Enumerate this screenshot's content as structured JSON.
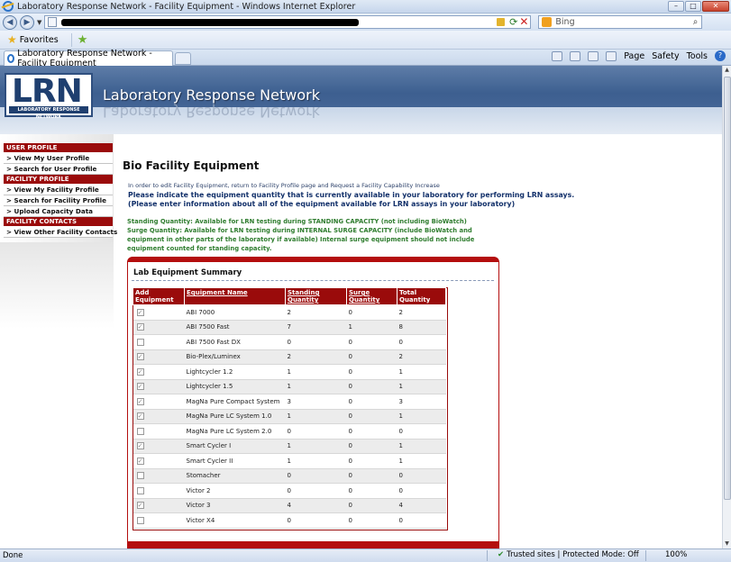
{
  "browser": {
    "window_title": "Laboratory Response Network - Facility Equipment - Windows Internet Explorer",
    "search_placeholder": "Bing",
    "favorites_label": "Favorites",
    "tab_title": "Laboratory Response Network - Facility Equipment",
    "cmd_page": "Page",
    "cmd_safety": "Safety",
    "cmd_tools": "Tools",
    "status_done": "Done",
    "status_zone": "Trusted sites | Protected Mode: Off",
    "status_zoom": "100%"
  },
  "site": {
    "logo_text": "LRN",
    "logo_subtext": "LABORATORY RESPONSE NETWORK",
    "title": "Laboratory Response Network"
  },
  "nav": {
    "user_profile_header": "USER PROFILE",
    "user_items": [
      "> View My User Profile",
      "> Search for User Profile"
    ],
    "facility_profile_header": "FACILITY PROFILE",
    "facility_items": [
      "> View My Facility Profile",
      "> Search for Facility Profile",
      "> Upload Capacity Data"
    ],
    "facility_contacts_header": "FACILITY CONTACTS",
    "contact_items": [
      "> View Other Facility Contacts"
    ]
  },
  "main": {
    "title": "Bio Facility Equipment",
    "edit_note": "In order to edit Facility Equipment, return to Facility Profile page and Request a Facility Capability Increase",
    "instruction_1": "Please indicate the equipment quantity that is currently available in your laboratory for performing LRN assays.",
    "instruction_2": "(Please enter information about all of the equipment available for LRN assays in your laboratory)",
    "standing_note": "Standing Quantity: Available for LRN testing during STANDING CAPACITY (not including BioWatch)",
    "surge_note": "Surge Quantity: Available for LRN testing during INTERNAL SURGE CAPACITY (include BioWatch and equipment in other parts of the laboratory if available) Internal surge equipment should not include equipment counted for standing capacity."
  },
  "panel": {
    "title": "Lab Equipment Summary",
    "headers": {
      "add": "Add Equipment",
      "name": "Equipment Name",
      "standing": "Standing Quantity",
      "surge": "Surge Quantity",
      "total": "Total Quantity"
    },
    "rows": [
      {
        "checked": true,
        "name": "ABI 7000",
        "standing": "2",
        "surge": "0",
        "total": "2"
      },
      {
        "checked": true,
        "name": "ABI 7500 Fast",
        "standing": "7",
        "surge": "1",
        "total": "8"
      },
      {
        "checked": false,
        "name": "ABI 7500 Fast DX",
        "standing": "0",
        "surge": "0",
        "total": "0"
      },
      {
        "checked": true,
        "name": "Bio-Plex/Luminex",
        "standing": "2",
        "surge": "0",
        "total": "2"
      },
      {
        "checked": true,
        "name": "Lightcycler 1.2",
        "standing": "1",
        "surge": "0",
        "total": "1"
      },
      {
        "checked": true,
        "name": "Lightcycler 1.5",
        "standing": "1",
        "surge": "0",
        "total": "1"
      },
      {
        "checked": true,
        "name": "MagNa Pure Compact System",
        "standing": "3",
        "surge": "0",
        "total": "3"
      },
      {
        "checked": true,
        "name": "MagNa Pure LC System 1.0",
        "standing": "1",
        "surge": "0",
        "total": "1"
      },
      {
        "checked": false,
        "name": "MagNa Pure LC System 2.0",
        "standing": "0",
        "surge": "0",
        "total": "0"
      },
      {
        "checked": true,
        "name": "Smart Cycler I",
        "standing": "1",
        "surge": "0",
        "total": "1"
      },
      {
        "checked": true,
        "name": "Smart Cycler II",
        "standing": "1",
        "surge": "0",
        "total": "1"
      },
      {
        "checked": false,
        "name": "Stomacher",
        "standing": "0",
        "surge": "0",
        "total": "0"
      },
      {
        "checked": false,
        "name": "Victor 2",
        "standing": "0",
        "surge": "0",
        "total": "0"
      },
      {
        "checked": true,
        "name": "Victor 3",
        "standing": "4",
        "surge": "0",
        "total": "4"
      },
      {
        "checked": false,
        "name": "Victor X4",
        "standing": "0",
        "surge": "0",
        "total": "0"
      }
    ]
  }
}
